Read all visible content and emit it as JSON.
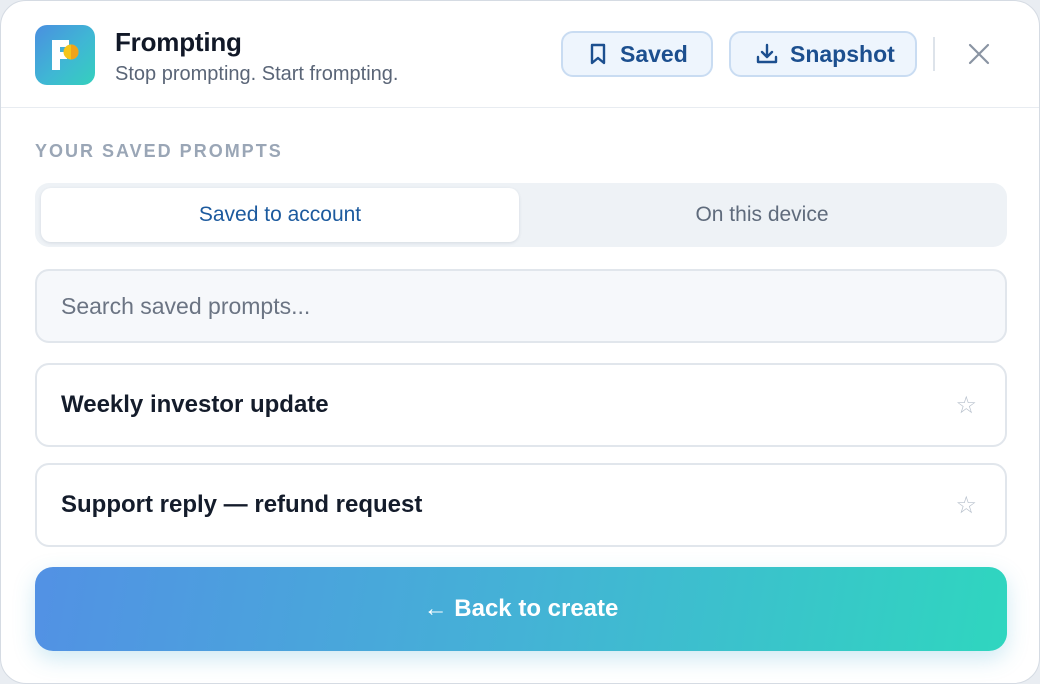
{
  "header": {
    "logo_icon": "frompting-logo-icon",
    "title": "Frompting",
    "subtitle": "Stop prompting. Start frompting.",
    "saved_button": {
      "label": "Saved",
      "icon": "bookmark-icon"
    },
    "snapshot_button": {
      "label": "Snapshot",
      "icon": "download-icon"
    },
    "close_icon": "close-icon"
  },
  "main": {
    "section_label": "YOUR SAVED PROMPTS",
    "tabs": [
      {
        "label": "Saved to account",
        "active": true
      },
      {
        "label": "On this device",
        "active": false
      }
    ],
    "search": {
      "placeholder": "Search saved prompts...",
      "value": ""
    },
    "items": [
      {
        "title": "Weekly investor update",
        "star": "☆"
      },
      {
        "title": "Support reply — refund request",
        "star": "☆"
      }
    ],
    "back_button": "← Back to create"
  },
  "colors": {
    "accent": "#1c4f8f",
    "gradient_start": "#5291e4",
    "gradient_end": "#2fd6bf",
    "logo_dot": "#f5c518"
  }
}
